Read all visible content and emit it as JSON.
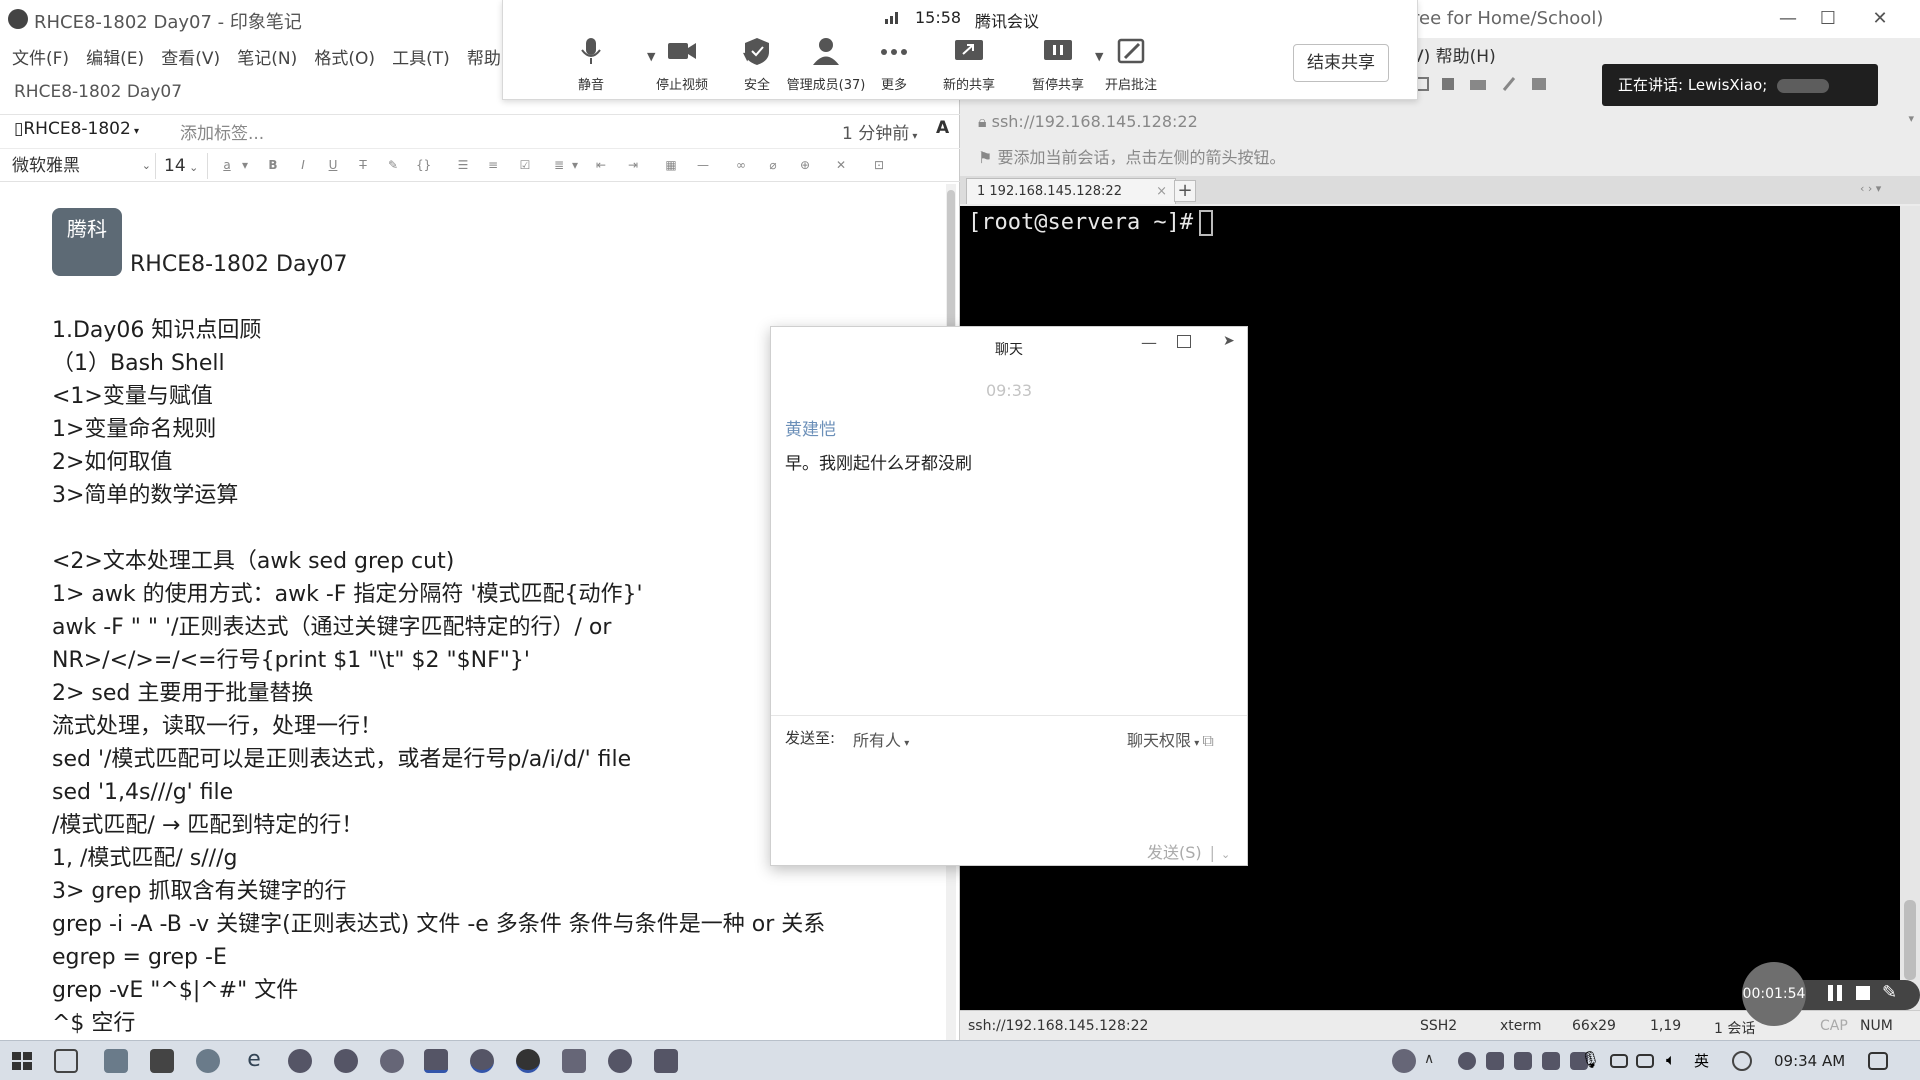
{
  "evernote": {
    "window_title": "RHCE8-1802 Day07 - 印象笔记",
    "menu": [
      "文件(F)",
      "编辑(E)",
      "查看(V)",
      "笔记(N)",
      "格式(O)",
      "工具(T)",
      "帮助"
    ],
    "note_title": "RHCE8-1802 Day07",
    "notebook": "RHCE8-1802",
    "add_tag": "添加标签...",
    "modified": "1 分钟前",
    "font_name": "微软雅黑",
    "font_size": "14",
    "avatar_text": "腾科",
    "heading": "RHCE8-1802 Day07",
    "lines": [
      "1.Day06 知识点回顾",
      "（1）Bash Shell",
      "<1>变量与赋值",
      "1>变量命名规则",
      "2>如何取值",
      "3>简单的数学运算",
      "",
      "<2>文本处理工具（awk sed grep cut)",
      "1> awk 的使用方式：awk -F 指定分隔符 '模式匹配{动作}'",
      "awk -F \" \" '/正则表达式（通过关键字匹配特定的行）/ or",
      "NR>/</>=/<=行号{print $1 \"\\t\" $2 \"$NF\"}'",
      "2> sed 主要用于批量替换",
      "流式处理，读取一行，处理一行！",
      "sed '/模式匹配可以是正则表达式，或者是行号p/a/i/d/' file",
      "sed '1,4s///g' file",
      "/模式匹配/ → 匹配到特定的行！",
      "1, /模式匹配/ s///g",
      "3> grep 抓取含有关键字的行",
      "grep -i -A -B -v 关键字(正则表达式) 文件 -e 多条件 条件与条件是一种 or 关系",
      "egrep = grep -E",
      "grep -vE \"^$|^#\" 文件",
      "^$ 空行"
    ]
  },
  "xshell": {
    "title_fragment": "ree for Home/School)",
    "menu_fragment": "V)  帮助(H)",
    "address": "ssh://192.168.145.128:22",
    "hint": "要添加当前会话，点击左侧的箭头按钮。",
    "tab_label": "1 192.168.145.128:22",
    "prompt": "[root@servera ~]#",
    "status": {
      "address": "ssh://192.168.145.128:22",
      "protocol": "SSH2",
      "term": "xterm",
      "size": "66x29",
      "position": "1,19",
      "sessions": "1 会话",
      "cap": "CAP",
      "num": "NUM"
    }
  },
  "meeting": {
    "time": "15:58",
    "app_name": "腾讯会议",
    "buttons": [
      "静音",
      "停止视频",
      "安全",
      "管理成员(37)",
      "更多",
      "新的共享",
      "暂停共享",
      "开启批注"
    ],
    "end_share": "结束共享",
    "speaking": "正在讲话: LewisXiao;"
  },
  "chat": {
    "title": "聊天",
    "time": "09:33",
    "sender": "黄建恺",
    "message": "早。我刚起什么牙都没刷",
    "send_to_label": "发送至:",
    "send_to": "所有人",
    "permission": "聊天权限",
    "send_button": "发送(S)"
  },
  "recording": {
    "elapsed": "00:01:54"
  },
  "taskbar": {
    "time": "09:34 AM"
  }
}
